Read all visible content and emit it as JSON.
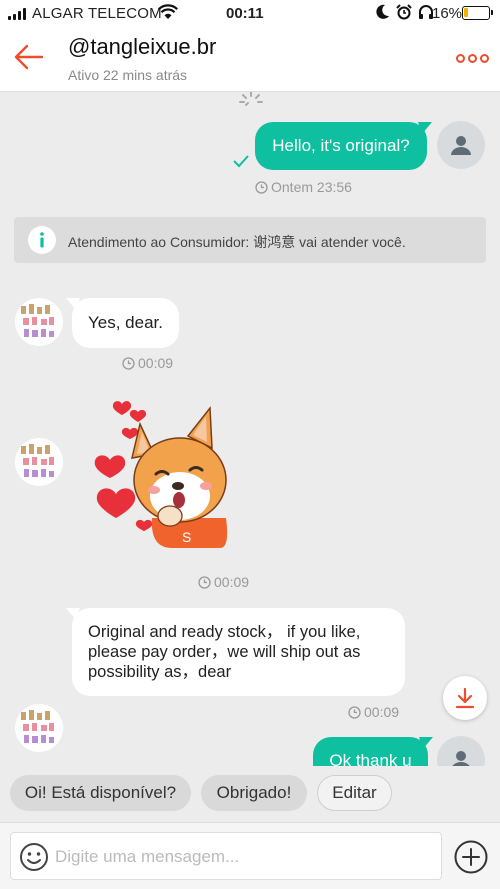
{
  "status_bar": {
    "carrier": "ALGAR TELECOM",
    "time": "00:11",
    "battery_percent": "16%",
    "battery_level": 0.16,
    "icons": [
      "signal-icon",
      "wifi-icon",
      "moon-icon",
      "alarm-icon",
      "headphones-icon",
      "battery-icon"
    ]
  },
  "header": {
    "title": "@tangleixue.br",
    "subtitle": "Ativo 22 mins atrás",
    "icons": [
      "back-arrow-icon",
      "more-options-icon"
    ]
  },
  "messages": {
    "out_1": {
      "text": "Hello, it's original?",
      "time": "Ontem 23:56",
      "status": "read-check-icon"
    },
    "notice": {
      "text": "Atendimento ao Consumidor: 谢鸿意 vai atender você.",
      "icon": "info-icon"
    },
    "in_1": {
      "text": "Yes, dear.",
      "time": "00:09"
    },
    "sticker": {
      "name": "corgi-hearts-sticker",
      "time": "00:09"
    },
    "in_2": {
      "text": "Original and ready stock， if you like, please pay order，we will ship out as possibility as，dear",
      "time": "00:09"
    },
    "out_2": {
      "text": "Ok thank u"
    }
  },
  "quick_replies": [
    "Oi! Está disponível?",
    "Obrigado!",
    "Editar"
  ],
  "input": {
    "placeholder": "Digite uma mensagem..."
  },
  "colors": {
    "accent": "#ee4d2d",
    "bubble_out": "#0ebfa0",
    "background": "#ececec"
  }
}
